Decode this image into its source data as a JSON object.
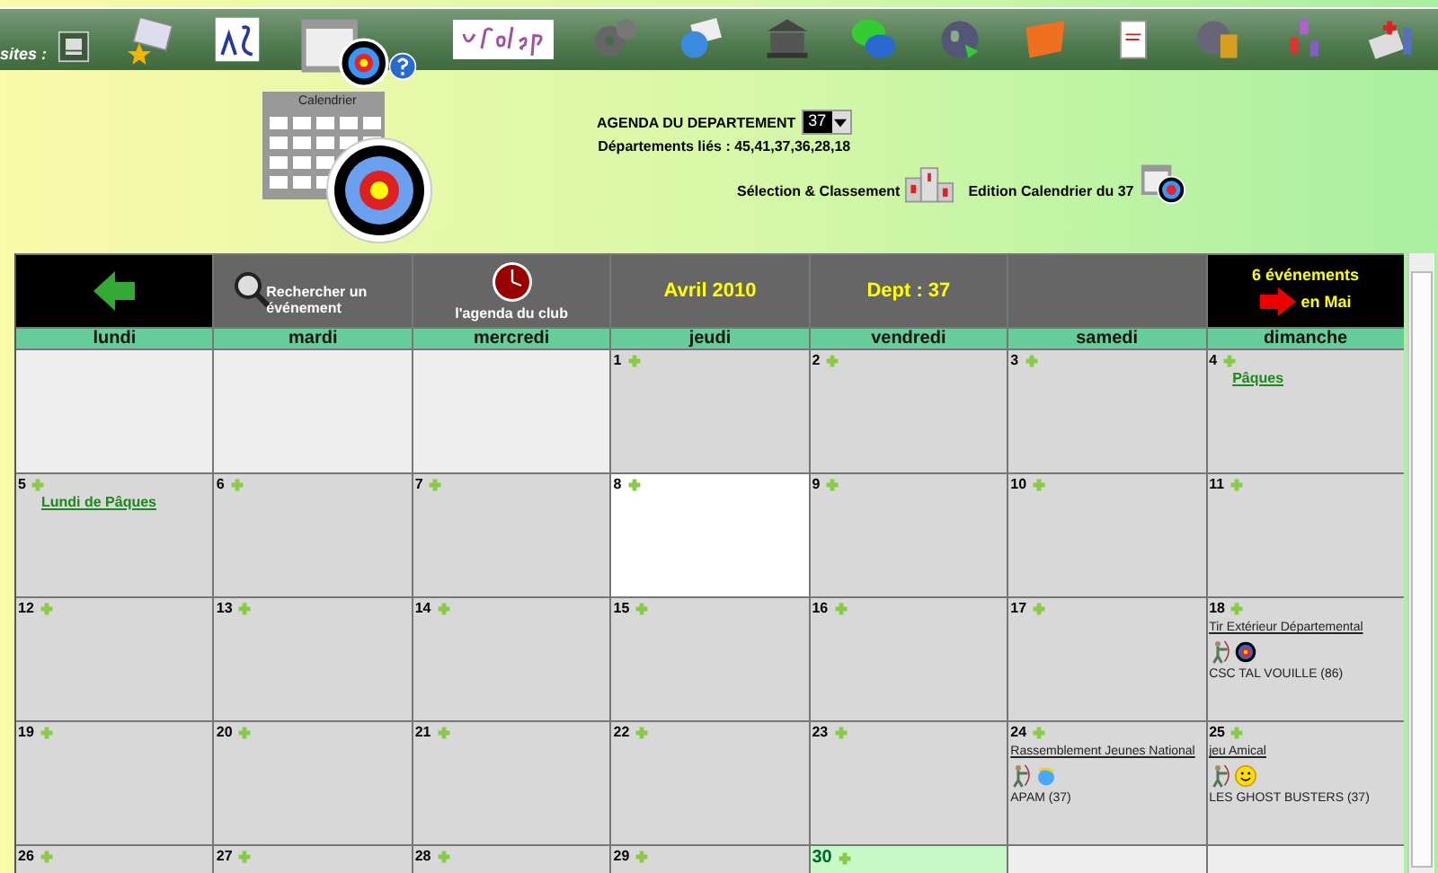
{
  "toolbar": {
    "sites_label": "sites :"
  },
  "header": {
    "agenda_label": "AGENDA DU DEPARTEMENT",
    "department": "37",
    "linked": "Départements liés : 45,41,37,36,28,18",
    "selection_link": "Sélection & Classement",
    "edition_link": "Edition Calendrier du 37",
    "calendar_caption": "Calendrier"
  },
  "nav": {
    "search": "Rechercher un événement",
    "club_agenda": "l'agenda du club",
    "month": "Avril 2010",
    "dept": "Dept : 37",
    "next_count": "6 événements",
    "next_month": "en Mai"
  },
  "weekdays": [
    "lundi",
    "mardi",
    "mercredi",
    "jeudi",
    "vendredi",
    "samedi",
    "dimanche"
  ],
  "weeks": [
    [
      {
        "kind": "blank"
      },
      {
        "kind": "blank"
      },
      {
        "kind": "blank"
      },
      {
        "kind": "day",
        "day": "1"
      },
      {
        "kind": "day",
        "day": "2"
      },
      {
        "kind": "day",
        "day": "3"
      },
      {
        "kind": "day",
        "day": "4",
        "events": [
          {
            "kind": "holiday",
            "title": "Pâques"
          }
        ]
      }
    ],
    [
      {
        "kind": "day",
        "day": "5",
        "events": [
          {
            "kind": "holiday",
            "title": "Lundi de Pâques"
          }
        ]
      },
      {
        "kind": "day",
        "day": "6"
      },
      {
        "kind": "day",
        "day": "7"
      },
      {
        "kind": "today",
        "day": "8"
      },
      {
        "kind": "day",
        "day": "9"
      },
      {
        "kind": "day",
        "day": "10"
      },
      {
        "kind": "day",
        "day": "11"
      }
    ],
    [
      {
        "kind": "day",
        "day": "12"
      },
      {
        "kind": "day",
        "day": "13"
      },
      {
        "kind": "day",
        "day": "14"
      },
      {
        "kind": "day",
        "day": "15"
      },
      {
        "kind": "day",
        "day": "16"
      },
      {
        "kind": "day",
        "day": "17"
      },
      {
        "kind": "day",
        "day": "18",
        "events": [
          {
            "kind": "target",
            "title": "Tir Extérieur Départemental",
            "club": "CSC TAL VOUILLE (86)"
          }
        ]
      }
    ],
    [
      {
        "kind": "day",
        "day": "19"
      },
      {
        "kind": "day",
        "day": "20"
      },
      {
        "kind": "day",
        "day": "21"
      },
      {
        "kind": "day",
        "day": "22"
      },
      {
        "kind": "day",
        "day": "23"
      },
      {
        "kind": "day",
        "day": "24",
        "events": [
          {
            "kind": "globe",
            "title": "Rassemblement Jeunes National",
            "club": "APAM (37)"
          }
        ]
      },
      {
        "kind": "day",
        "day": "25",
        "events": [
          {
            "kind": "smiley",
            "title": "jeu Amical",
            "club": "LES GHOST BUSTERS (37)"
          }
        ]
      }
    ],
    [
      {
        "kind": "day",
        "day": "26"
      },
      {
        "kind": "day",
        "day": "27"
      },
      {
        "kind": "day",
        "day": "28"
      },
      {
        "kind": "day",
        "day": "29"
      },
      {
        "kind": "last",
        "day": "30"
      },
      {
        "kind": "blank"
      },
      {
        "kind": "blank"
      }
    ]
  ]
}
